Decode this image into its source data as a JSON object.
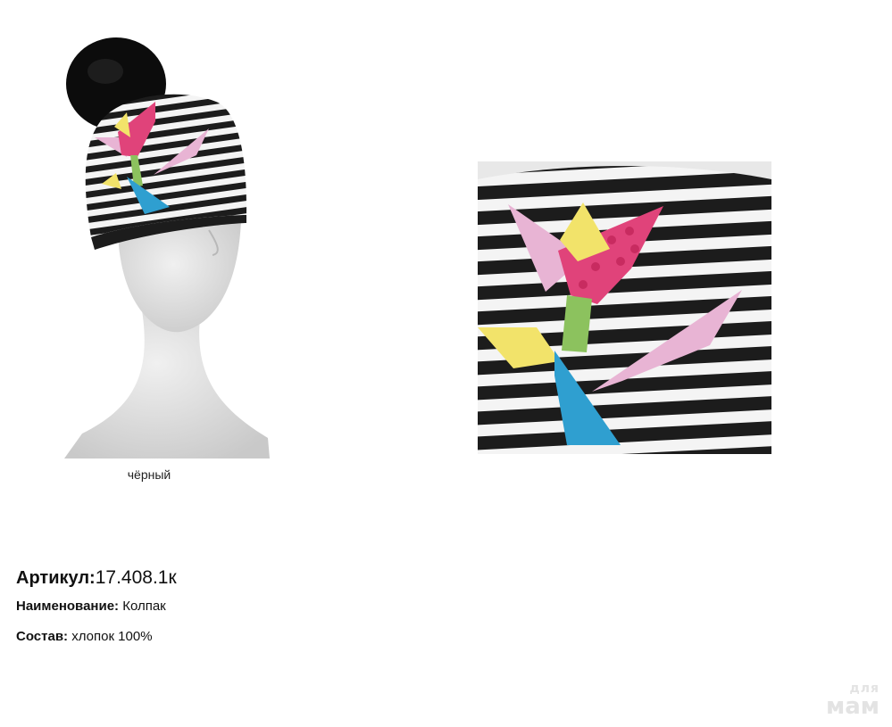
{
  "product": {
    "color_caption": "чёрный",
    "article_label": "Артикул:",
    "article_value": "17.408.1к",
    "name_label": "Наименование:",
    "name_value": "Колпак",
    "composition_label": "Состав:",
    "composition_value": "хлопок 100%"
  },
  "images": {
    "main_photo": "striped-hat-on-mannequin",
    "detail_photo": "flower-appliqué-closeup"
  },
  "colors": {
    "stripe_dark": "#1c1c1c",
    "stripe_light": "#f4f4f4",
    "pompom": "#0c0c0c",
    "mannequin": "#e2e2e2",
    "petal_pink": "#e8b4d4",
    "flower_magenta": "#e0437a",
    "stem_green": "#8cc25e",
    "leaf_blue": "#2f9fd0",
    "sequin_yellow": "#f2e36a"
  },
  "watermark": {
    "top": "для",
    "bottom": "мам"
  }
}
